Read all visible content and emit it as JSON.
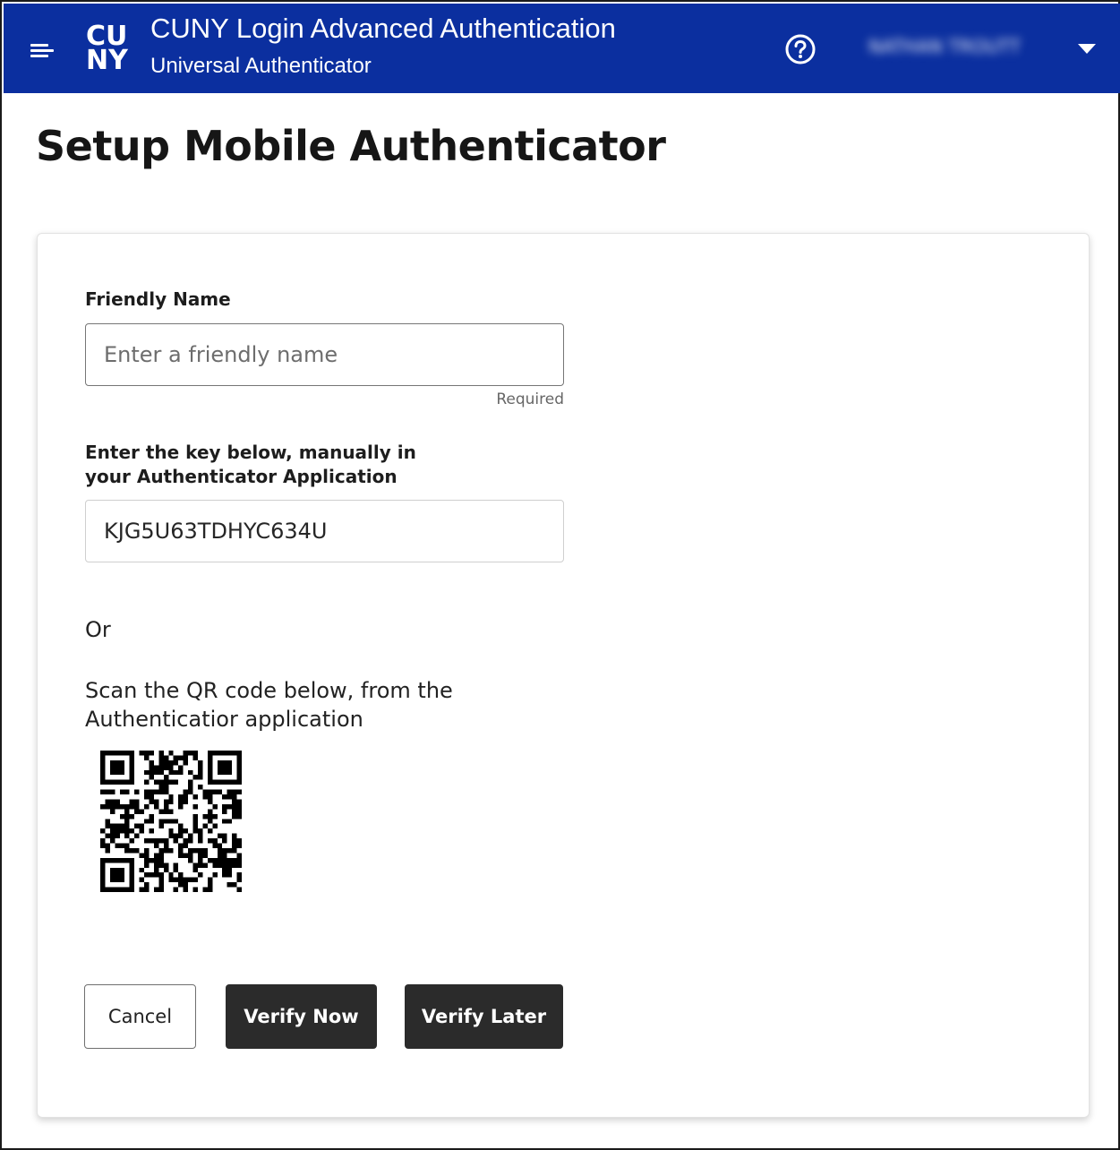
{
  "header": {
    "title": "CUNY Login Advanced Authentication",
    "subtitle": "Universal Authenticator",
    "logo_text_top": "CU",
    "logo_text_bottom": "NY",
    "user_name": "NATHAN TROUTT",
    "icons": {
      "menu": "menu-icon",
      "help": "help-circle-icon",
      "dropdown": "caret-down-icon"
    },
    "color": "#0b2f9f"
  },
  "page": {
    "title": "Setup Mobile Authenticator"
  },
  "form": {
    "friendly_name": {
      "label": "Friendly Name",
      "placeholder": "Enter a friendly name",
      "value": "",
      "helper": "Required"
    },
    "key": {
      "label": "Enter the key below, manually in your Authenticator Application",
      "value": "KJG5U63TDHYC634U"
    },
    "or_text": "Or",
    "scan_text": "Scan the QR code below, from the Authenticatior application"
  },
  "buttons": {
    "cancel": "Cancel",
    "verify_now": "Verify Now",
    "verify_later": "Verify Later"
  }
}
